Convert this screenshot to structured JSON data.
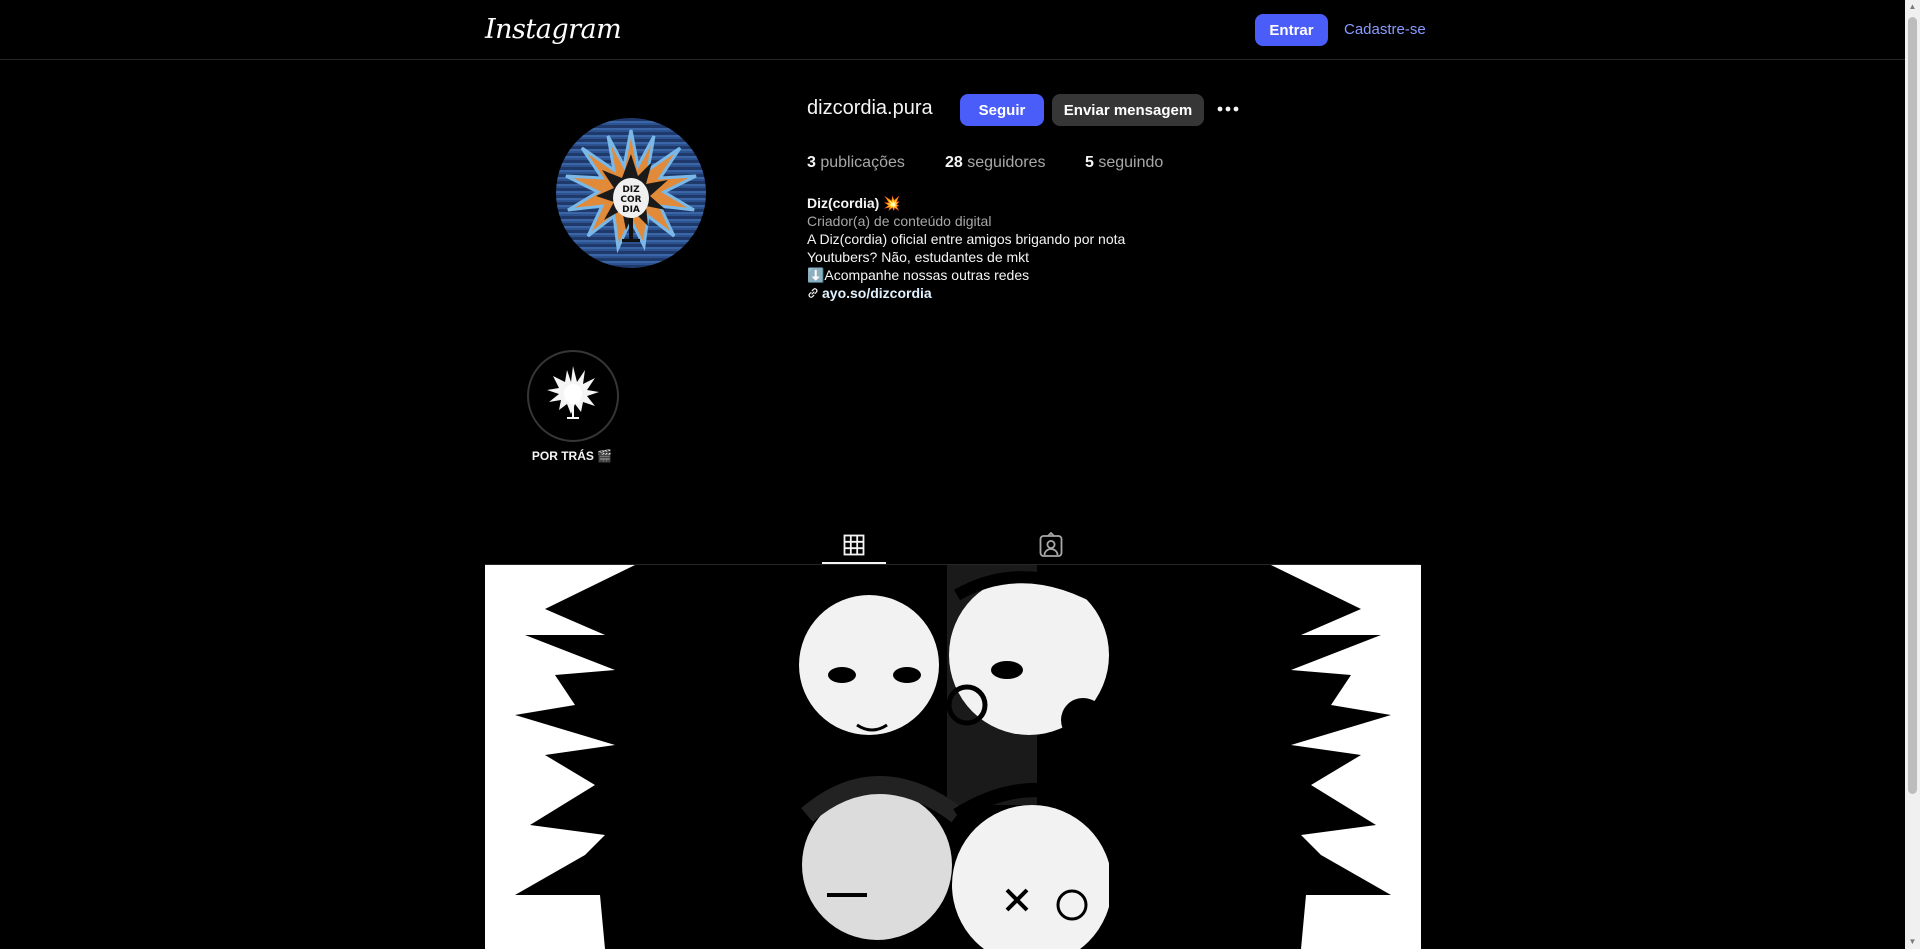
{
  "nav": {
    "logo_text": "Instagram",
    "login_label": "Entrar",
    "signup_label": "Cadastre-se"
  },
  "profile": {
    "username": "dizcordia.pura",
    "follow_label": "Seguir",
    "message_label": "Enviar mensagem",
    "avatar_lettering": "DIZ COR DIA",
    "stats": {
      "posts_count": "3",
      "posts_label": "publicações",
      "followers_count": "28",
      "followers_label": "seguidores",
      "following_count": "5",
      "following_label": "seguindo"
    },
    "bio": {
      "name": "Diz(cordia) 💥",
      "category": "Criador(a) de conteúdo digital",
      "line1": "A Diz(cordia) oficial entre amigos brigando por nota",
      "line2": "Youtubers? Não, estudantes de mkt",
      "line3": "⬇️Acompanhe nossas outras redes",
      "link": "ayo.so/dizcordia"
    }
  },
  "highlights": [
    {
      "label": "POR TRÁS 🎬"
    }
  ],
  "tabs": [
    {
      "icon": "grid-icon",
      "active": true
    },
    {
      "icon": "tagged-icon",
      "active": false
    }
  ],
  "posts": [
    {
      "type": "spiky-graphic",
      "multi": false
    },
    {
      "type": "illustrated-faces",
      "multi": true
    },
    {
      "type": "spiky-graphic",
      "multi": false
    }
  ]
}
